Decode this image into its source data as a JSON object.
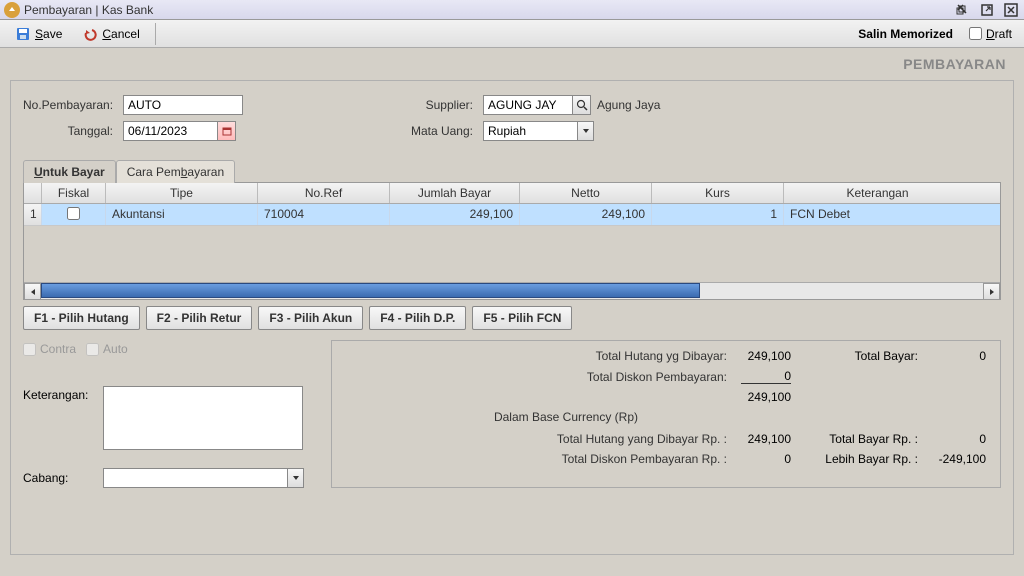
{
  "window": {
    "title": "Pembayaran | Kas Bank"
  },
  "toolbar": {
    "save_label": "Save",
    "cancel_label": "Cancel",
    "salin_label": "Salin Memorized",
    "draft_label": "Draft"
  },
  "module_title": "PEMBAYARAN",
  "form": {
    "no_label": "No.Pembayaran:",
    "no_value": "AUTO",
    "tanggal_label": "Tanggal:",
    "tanggal_value": "06/11/2023",
    "supplier_label": "Supplier:",
    "supplier_value": "AGUNG JAY",
    "supplier_name": "Agung Jaya",
    "mata_uang_label": "Mata Uang:",
    "mata_uang_value": "Rupiah"
  },
  "tabs": {
    "untuk_bayar": "Untuk Bayar",
    "cara_pembayaran": "Cara Pembayaran"
  },
  "grid": {
    "headers": {
      "fiskal": "Fiskal",
      "tipe": "Tipe",
      "ref": "No.Ref",
      "jumlah": "Jumlah Bayar",
      "netto": "Netto",
      "kurs": "Kurs",
      "ket": "Keterangan"
    },
    "rows": [
      {
        "num": "1",
        "fiskal_checked": false,
        "tipe": "Akuntansi",
        "ref": "710004",
        "jumlah": "249,100",
        "netto": "249,100",
        "kurs": "1",
        "ket": "FCN Debet"
      }
    ]
  },
  "fn": {
    "f1": "F1 - Pilih Hutang",
    "f2": "F2 - Pilih Retur",
    "f3": "F3 - Pilih Akun",
    "f4": "F4 - Pilih D.P.",
    "f5": "F5 - Pilih FCN"
  },
  "checks": {
    "contra": "Contra",
    "auto": "Auto"
  },
  "lower_left": {
    "keterangan_label": "Keterangan:",
    "keterangan_value": "",
    "cabang_label": "Cabang:",
    "cabang_value": ""
  },
  "summary": {
    "total_hutang_label": "Total Hutang yg Dibayar:",
    "total_hutang_val": "249,100",
    "total_bayar_label": "Total Bayar:",
    "total_bayar_val": "0",
    "total_diskon_label": "Total Diskon Pembayaran:",
    "total_diskon_val": "0",
    "subtotal_val": "249,100",
    "base_currency_label": "Dalam Base Currency (Rp)",
    "total_hutang_rp_label": "Total Hutang yang Dibayar Rp. :",
    "total_hutang_rp_val": "249,100",
    "total_bayar_rp_label": "Total Bayar Rp. :",
    "total_bayar_rp_val": "0",
    "total_diskon_rp_label": "Total Diskon Pembayaran Rp. :",
    "total_diskon_rp_val": "0",
    "lebih_bayar_rp_label": "Lebih Bayar Rp. :",
    "lebih_bayar_rp_val": "-249,100"
  }
}
